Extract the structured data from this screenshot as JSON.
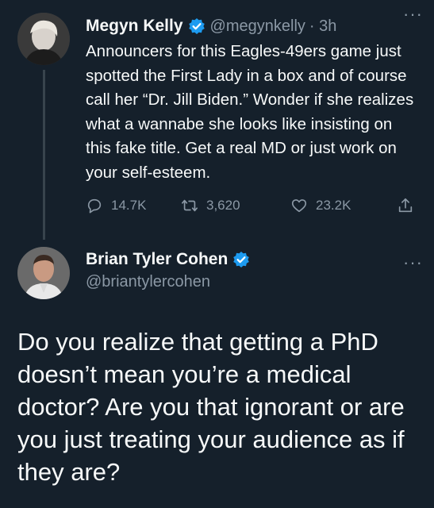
{
  "tweet1": {
    "author_name": "Megyn Kelly",
    "handle": "@megynkelly",
    "time": "· 3h",
    "text": "Announcers for this Eagles-49ers game just spotted the First Lady in a box and of course call her “Dr. Jill Biden.” Wonder if she realizes what a wannabe she looks like insisting on this fake title. Get a real MD or just work on your self-esteem.",
    "replies": "14.7K",
    "retweets": "3,620",
    "likes": "23.2K"
  },
  "tweet2": {
    "author_name": "Brian Tyler Cohen",
    "handle": "@briantylercohen",
    "text": "Do you realize that getting a PhD doesn’t mean you’re a medical doctor? Are you that ignorant or are you just treating your audience as if they are?"
  },
  "icons": {
    "verified": "verified-badge-icon",
    "more": "more-dots-icon",
    "reply": "reply-icon",
    "retweet": "retweet-icon",
    "like": "heart-icon",
    "share": "share-icon"
  },
  "colors": {
    "background": "#15202b",
    "verified": "#1d9bf0",
    "muted": "#8b98a5",
    "text": "#f7f9f9"
  }
}
